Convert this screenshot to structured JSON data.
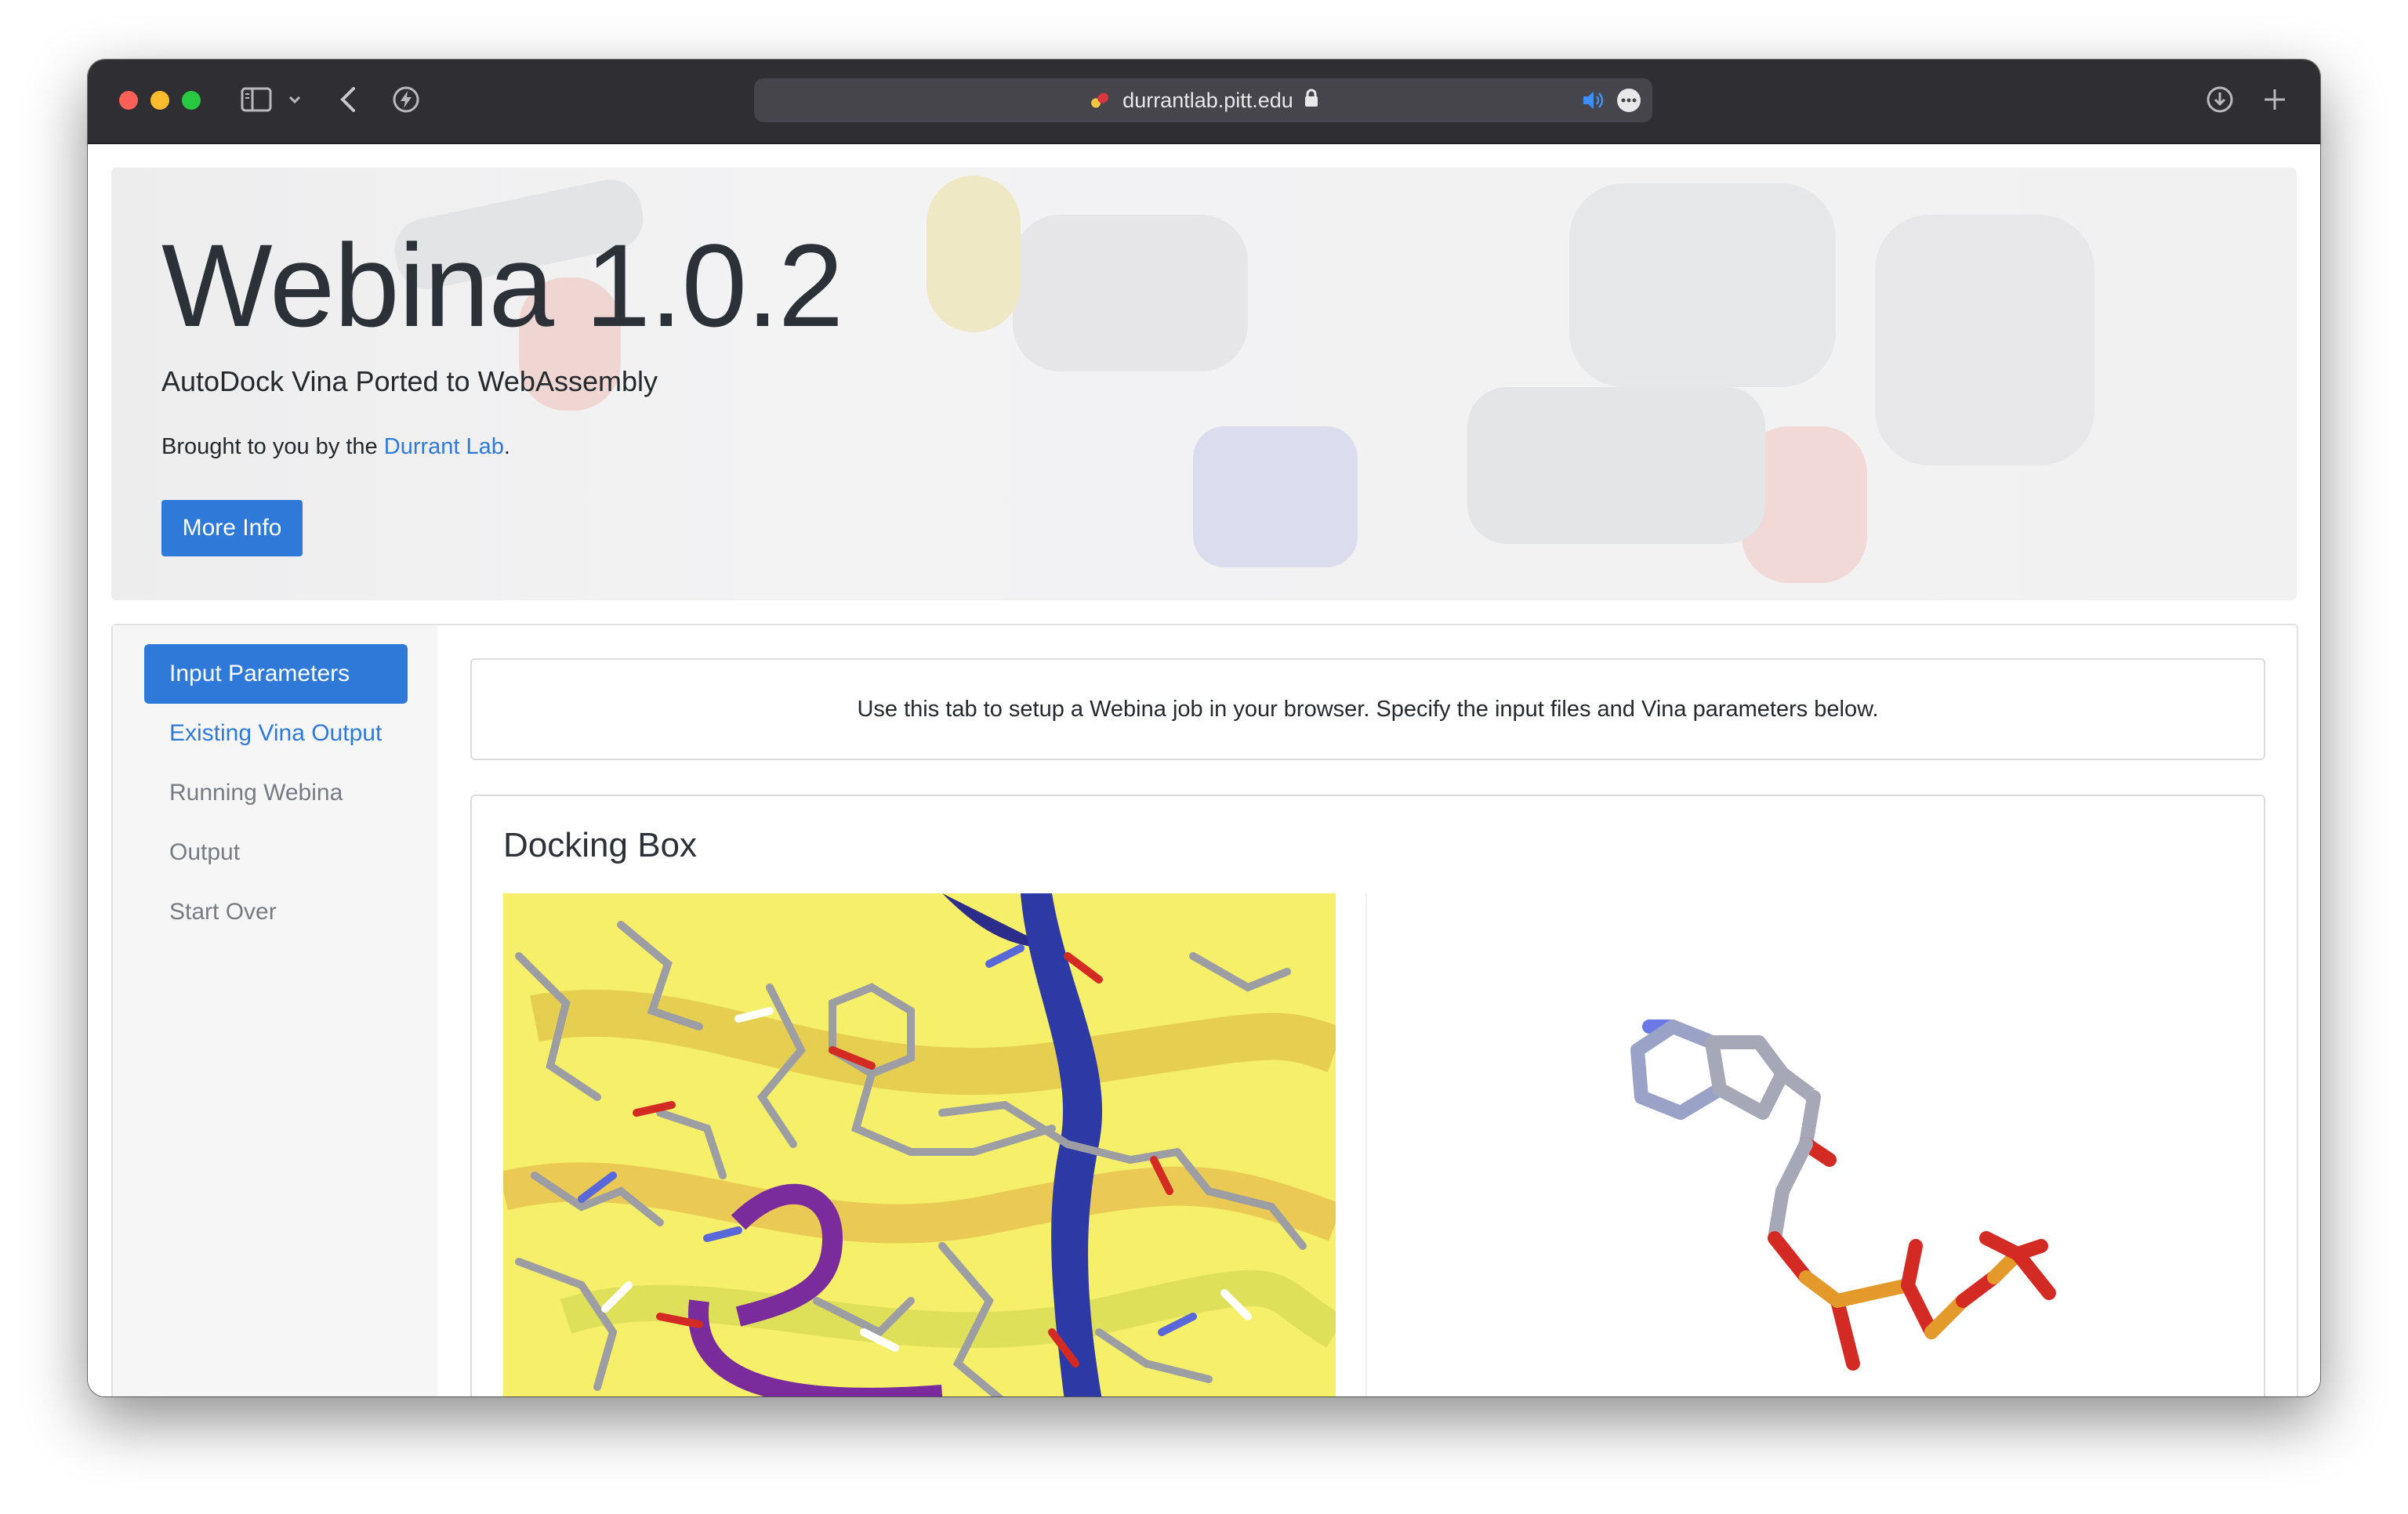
{
  "browser": {
    "url": "durrantlab.pitt.edu"
  },
  "header": {
    "title": "Webina 1.0.2",
    "subtitle": "AutoDock Vina Ported to WebAssembly",
    "brought_prefix": "Brought to you by the ",
    "lab_link": "Durrant Lab",
    "brought_suffix": ".",
    "more_info_button": "More Info"
  },
  "sidebar": {
    "items": [
      {
        "label": "Input Parameters",
        "state": "active"
      },
      {
        "label": "Existing Vina Output",
        "state": "link"
      },
      {
        "label": "Running Webina",
        "state": "disabled"
      },
      {
        "label": "Output",
        "state": "disabled"
      },
      {
        "label": "Start Over",
        "state": "disabled"
      }
    ]
  },
  "main": {
    "intro_text": "Use this tab to setup a Webina job in your browser. Specify the input files and Vina parameters below.",
    "docking_box_title": "Docking Box"
  },
  "colors": {
    "primary": "#2f7ad8",
    "protein_background": "#f4ef62"
  }
}
